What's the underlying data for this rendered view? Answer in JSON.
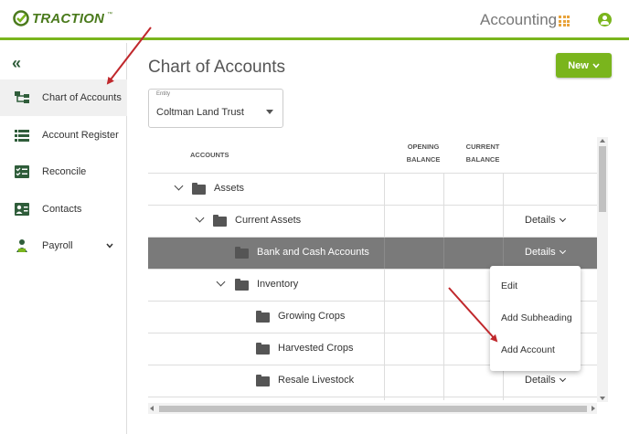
{
  "header": {
    "logo_text": "TRACTION",
    "logo_tm": "™",
    "module_title": "Accounting"
  },
  "sidebar": {
    "collapse_glyph": "«",
    "items": [
      {
        "label": "Chart of Accounts",
        "icon": "hierarchy-icon",
        "active": true
      },
      {
        "label": "Account Register",
        "icon": "list-icon"
      },
      {
        "label": "Reconcile",
        "icon": "checklist-icon"
      },
      {
        "label": "Contacts",
        "icon": "contact-card-icon"
      },
      {
        "label": "Payroll",
        "icon": "person-money-icon",
        "has_submenu": true
      }
    ]
  },
  "main": {
    "title": "Chart of Accounts",
    "new_button": "New",
    "entity": {
      "label": "Entity",
      "value": "Coltman Land Trust"
    }
  },
  "table": {
    "headers": {
      "accounts": "ACCOUNTS",
      "opening_line1": "OPENING",
      "opening_line2": "BALANCE",
      "current_line1": "CURRENT",
      "current_line2": "BALANCE"
    },
    "rows": [
      {
        "label": "Assets",
        "level": 0,
        "expanded": true,
        "details": ""
      },
      {
        "label": "Current Assets",
        "level": 1,
        "expanded": true,
        "details": "Details"
      },
      {
        "label": "Bank and Cash Accounts",
        "level": 2,
        "selected": true,
        "details": "Details"
      },
      {
        "label": "Inventory",
        "level": 2,
        "expanded": true,
        "details": ""
      },
      {
        "label": "Growing Crops",
        "level": 3,
        "details": ""
      },
      {
        "label": "Harvested Crops",
        "level": 3,
        "details": ""
      },
      {
        "label": "Resale Livestock",
        "level": 3,
        "details": "Details"
      }
    ]
  },
  "details_menu": {
    "items": [
      "Edit",
      "Add Subheading",
      "Add Account"
    ]
  },
  "colors": {
    "brand_green": "#7ab51d",
    "selected_row": "#7a7a7a",
    "annotation_red": "#c0282c",
    "module_icon": "#e8a33b"
  }
}
